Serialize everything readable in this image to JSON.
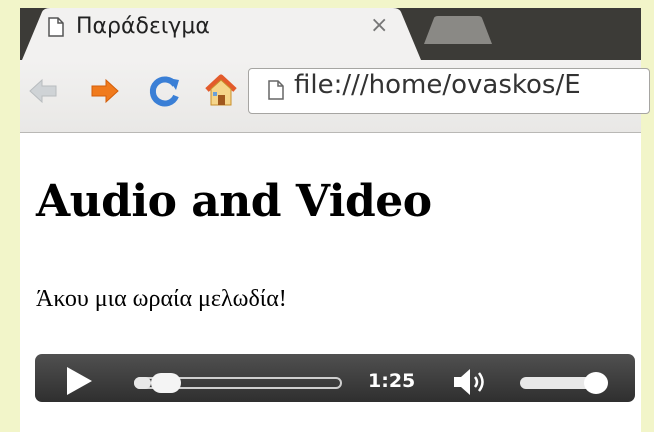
{
  "browser": {
    "tab_title": "Παράδειγμα",
    "tab_close": "×",
    "url": "file:///home/ovaskos/E"
  },
  "page": {
    "heading": "Audio and Video",
    "paragraph": "Άκου μια ωραία μελωδία!"
  },
  "audio_player": {
    "time": "1:25",
    "progress_fraction": 0.08,
    "volume_fraction": 0.85
  },
  "colors": {
    "page_background": "#f2f5c9",
    "home_icon": "#e35b2b",
    "forward_arrow": "#f07a1c",
    "reload_icon": "#3a7fd6"
  }
}
